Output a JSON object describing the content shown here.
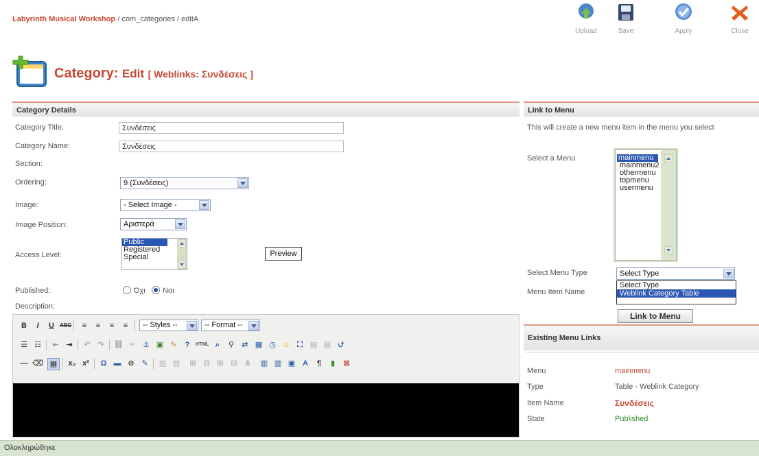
{
  "breadcrumb": {
    "site": "Labyrinth Musical Workshop",
    "path": " / com_categories / editA"
  },
  "toolbar": {
    "upload": "Upload",
    "save": "Save",
    "apply": "Apply",
    "close": "Close"
  },
  "page": {
    "title": "Category:",
    "subtitle": "Edit",
    "context": "[ Weblinks: Συνδέσεις ]"
  },
  "details": {
    "header": "Category Details",
    "title_label": "Category Title:",
    "title_value": "Συνδέσεις",
    "name_label": "Category Name:",
    "name_value": "Συνδέσεις",
    "section_label": "Section:",
    "ordering_label": "Ordering:",
    "ordering_value": "9 (Συνδέσεις)",
    "image_label": "Image:",
    "image_value": "- Select Image -",
    "position_label": "Image Position:",
    "position_value": "Αριστερά",
    "access_label": "Access Level:",
    "access_options": [
      "Public",
      "Registered",
      "Special"
    ],
    "preview": "Preview",
    "published_label": "Published:",
    "published_no": "Όχι",
    "published_yes": "Ναι",
    "description_label": "Description:"
  },
  "editor": {
    "styles": "-- Styles --",
    "format": "-- Format --"
  },
  "link_menu": {
    "header": "Link to Menu",
    "info": "This will create a new menu item in the menu you select",
    "select_menu_label": "Select a Menu",
    "menus": [
      "mainmenu",
      "mainmenu2",
      "othermenu",
      "topmenu",
      "usermenu"
    ],
    "menu_type_label": "Select Menu Type",
    "menu_type_value": "Select Type",
    "menu_type_options": [
      "Select Type",
      "Weblink Category Table"
    ],
    "item_name_label": "Menu Item Name",
    "button": "Link to Menu"
  },
  "existing": {
    "header": "Existing Menu Links",
    "menu_label": "Menu",
    "menu_value": "mainmenu",
    "type_label": "Type",
    "type_value": "Table - Weblink Category",
    "item_label": "Item Name",
    "item_value": "Συνδέσεις",
    "state_label": "State",
    "state_value": "Published"
  },
  "status": {
    "text": "Ολοκληρώθηκε"
  },
  "colors": {
    "accent": "#c64934",
    "selection": "#2b56b3",
    "published": "#2c8a2c"
  }
}
